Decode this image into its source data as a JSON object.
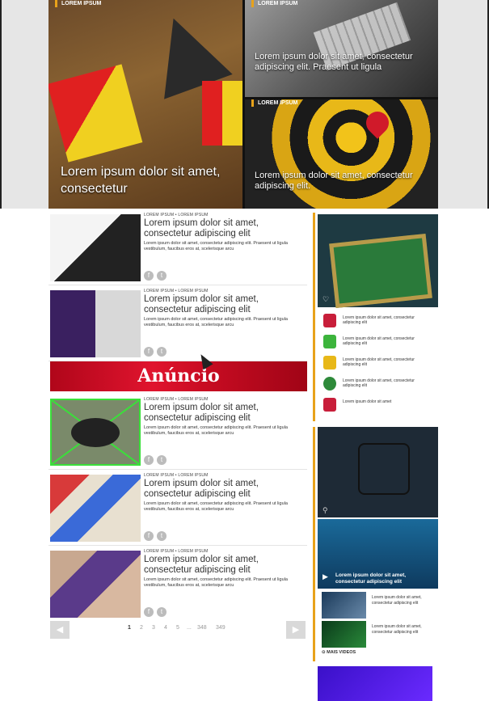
{
  "hero": {
    "tag": "LOREM IPSUM",
    "main_caption": "Lorem ipsum dolor sit amet, consectetur",
    "top_right_caption": "Lorem ipsum dolor sit amet, consectetur adipiscing elit. Praesent ut ligula",
    "bottom_right_caption": "Lorem ipsum dolor sit amet, consectetur adipiscing elit."
  },
  "articles": [
    {
      "meta": "LOREM IPSUM • LOREM IPSUM",
      "title": "Lorem ipsum dolor sit amet, consectetur adipiscing elit",
      "desc": "Lorem ipsum dolor sit amet, consectetur adipiscing elit. Praesent ut ligula vestibulum, faucibus eros at, scelerisque arcu"
    },
    {
      "meta": "LOREM IPSUM • LOREM IPSUM",
      "title": "Lorem ipsum dolor sit amet, consectetur adipiscing elit",
      "desc": "Lorem ipsum dolor sit amet, consectetur adipiscing elit. Praesent ut ligula vestibulum, faucibus eros at, scelerisque arcu"
    },
    {
      "meta": "LOREM IPSUM • LOREM IPSUM",
      "title": "Lorem ipsum dolor sit amet, consectetur adipiscing elit",
      "desc": "Lorem ipsum dolor sit amet, consectetur adipiscing elit. Praesent ut ligula vestibulum, faucibus eros at, scelerisque arcu"
    },
    {
      "meta": "LOREM IPSUM • LOREM IPSUM",
      "title": "Lorem ipsum dolor sit amet, consectetur adipiscing elit",
      "desc": "Lorem ipsum dolor sit amet, consectetur adipiscing elit. Praesent ut ligula vestibulum, faucibus eros at, scelerisque arcu"
    },
    {
      "meta": "LOREM IPSUM • LOREM IPSUM",
      "title": "Lorem ipsum dolor sit amet, consectetur adipiscing elit",
      "desc": "Lorem ipsum dolor sit amet, consectetur adipiscing elit. Praesent ut ligula vestibulum, faucibus eros at, scelerisque arcu"
    }
  ],
  "ad": {
    "label": "Anúncio"
  },
  "pagination": {
    "pages": [
      "1",
      "2",
      "3",
      "4",
      "5",
      "...",
      "348",
      "349"
    ],
    "current": "1"
  },
  "sidebar": {
    "list": [
      {
        "text": "Lorem ipsum dolor sit amet, consectetur adipiscing elit",
        "color": "#c81e3a"
      },
      {
        "text": "Lorem ipsum dolor sit amet, consectetur adipiscing elit",
        "color": "#3cb43c"
      },
      {
        "text": "Lorem ipsum dolor sit amet, consectetur adipiscing elit",
        "color": "#e8b818"
      },
      {
        "text": "Lorem ipsum dolor sit amet, consectetur adipiscing elit",
        "color": "#2e8a3a"
      },
      {
        "text": "Lorem ipsum dolor sit amet",
        "color": "#c81e3a"
      }
    ],
    "video_caption": "Lorem ipsum dolor sit amet, consectetur adipiscing elit",
    "videos": [
      {
        "text": "Lorem ipsum dolor sit amet, consectetur adipiscing elit"
      },
      {
        "text": "Lorem ipsum dolor sit amet, consectetur adipiscing elit"
      }
    ],
    "more_videos": "MAIS VIDEOS"
  },
  "colors": {
    "accent": "#e8a21a",
    "ad_red": "#d10f28"
  }
}
